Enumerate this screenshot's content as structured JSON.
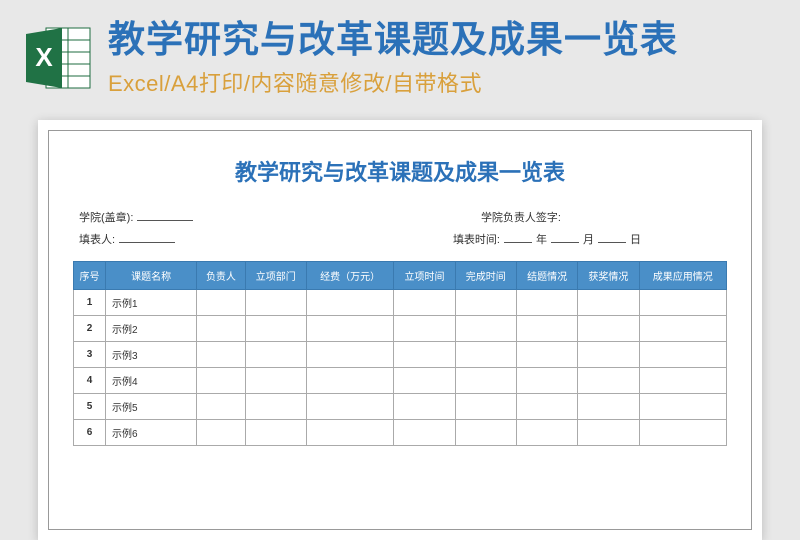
{
  "header": {
    "main_title": "教学研究与改革课题及成果一览表",
    "subtitle": "Excel/A4打印/内容随意修改/自带格式"
  },
  "document": {
    "title": "教学研究与改革课题及成果一览表",
    "meta": {
      "college_label": "学院(盖章):",
      "leader_label": "学院负责人签字:",
      "filler_label": "填表人:",
      "time_label": "填表时间:",
      "year": "年",
      "month": "月",
      "day": "日"
    },
    "table": {
      "headers": [
        "序号",
        "课题名称",
        "负责人",
        "立项部门",
        "经费（万元）",
        "立项时间",
        "完成时间",
        "结题情况",
        "获奖情况",
        "成果应用情况"
      ],
      "rows": [
        {
          "seq": "1",
          "name": "示例1"
        },
        {
          "seq": "2",
          "name": "示例2"
        },
        {
          "seq": "3",
          "name": "示例3"
        },
        {
          "seq": "4",
          "name": "示例4"
        },
        {
          "seq": "5",
          "name": "示例5"
        },
        {
          "seq": "6",
          "name": "示例6"
        }
      ]
    }
  }
}
